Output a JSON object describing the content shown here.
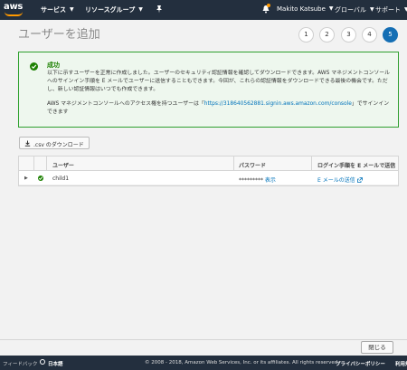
{
  "nav": {
    "logo": "aws",
    "services": "サービス",
    "resource_groups": "リソースグループ",
    "user": "Makito Katsube",
    "region": "グローバル",
    "support": "サポート"
  },
  "page": {
    "title": "ユーザーを追加",
    "steps": [
      "1",
      "2",
      "3",
      "4",
      "5"
    ],
    "active_step": "5"
  },
  "success": {
    "title": "成功",
    "body1": "以下に示すユーザーを正常に作成しました。ユーザーのセキュリティ認証情報を確認してダウンロードできます。AWS マネジメントコンソールへのサインイン手順を E メールでユーザーに送信することもできます。今回が、これらの認証情報をダウンロードできる最後の機会です。ただし、新しい認証情報はいつでも作成できます。",
    "body2_prefix": "AWS マネジメントコンソールへのアクセス権を持つユーザーは「",
    "body2_link": "https://318640562881.signin.aws.amazon.com/console",
    "body2_suffix": "」でサインインできます"
  },
  "download_button": ".csv のダウンロード",
  "table": {
    "headers": [
      "ユーザー",
      "パスワード",
      "ログイン手順を E メールで送信"
    ],
    "rows": [
      {
        "user": "child1",
        "password_mask": "*********",
        "show": "表示",
        "email_link": "E メールの送信"
      }
    ]
  },
  "close_button": "閉じる",
  "footer": {
    "feedback": "フィードバック",
    "language": "日本語",
    "copyright": "© 2008 - 2018, Amazon Web Services, Inc. or its affiliates. All rights reserved.",
    "privacy": "プライバシーポリシー",
    "terms": "利用規"
  },
  "colors": {
    "nav_bg": "#232f3e",
    "accent_orange": "#ff9900",
    "success_green": "#1d8102",
    "link_blue": "#0073bb",
    "step_active": "#146eb4"
  }
}
